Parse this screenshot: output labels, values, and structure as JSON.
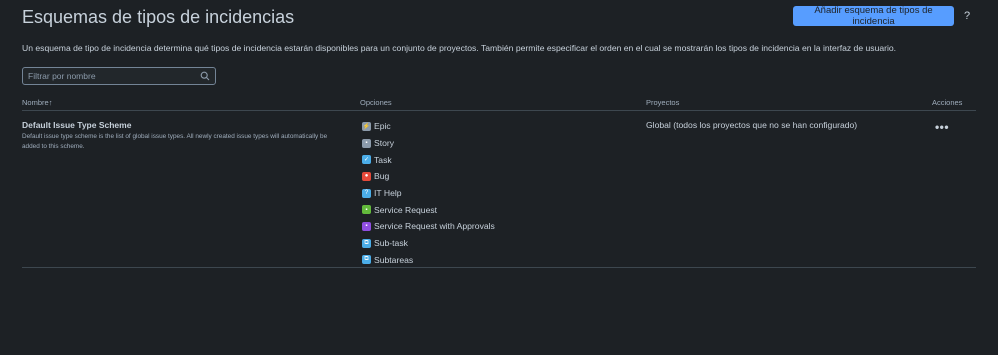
{
  "page": {
    "title": "Esquemas de tipos de incidencias",
    "add_button_label": "Añadir esquema de tipos de incidencia",
    "help_label": "?",
    "description": "Un esquema de tipo de incidencia determina qué tipos de incidencia estarán disponibles para un conjunto de proyectos. También permite especificar el orden en el cual se mostrarán los tipos de incidencia en la interfaz de usuario."
  },
  "search": {
    "placeholder": "Filtrar por nombre",
    "icon": "search-icon"
  },
  "table": {
    "columns": {
      "name": "Nombre",
      "name_sort_indicator": "↑",
      "options": "Opciones",
      "projects": "Proyectos",
      "actions": "Acciones"
    },
    "rows": [
      {
        "name": "Default Issue Type Scheme",
        "description": "Default issue type scheme is the list of global issue types. All newly created issue types will automatically be added to this scheme.",
        "projects": "Global (todos los proyectos que no se han configurado)",
        "actions_label": "•••",
        "options": [
          {
            "label": "Epic",
            "icon": "epic-icon",
            "color": "#8c9bab"
          },
          {
            "label": "Story",
            "icon": "story-icon",
            "color": "#8c9bab"
          },
          {
            "label": "Task",
            "icon": "task-icon",
            "color": "#4bade8"
          },
          {
            "label": "Bug",
            "icon": "bug-icon",
            "color": "#e5493a"
          },
          {
            "label": "IT Help",
            "icon": "it-help-icon",
            "color": "#4bade8"
          },
          {
            "label": "Service Request",
            "icon": "service-request-icon",
            "color": "#63ba3c"
          },
          {
            "label": "Service Request with Approvals",
            "icon": "service-request-approvals-icon",
            "color": "#904ee2"
          },
          {
            "label": "Sub-task",
            "icon": "subtask-icon",
            "color": "#4bade8"
          },
          {
            "label": "Subtareas",
            "icon": "subtask-icon",
            "color": "#4bade8"
          }
        ]
      }
    ]
  },
  "colors": {
    "background": "#1d2125",
    "primary_button": "#579dff",
    "text": "#c7d1db",
    "subtle_text": "#9fadbc",
    "divider": "#3d474f"
  }
}
